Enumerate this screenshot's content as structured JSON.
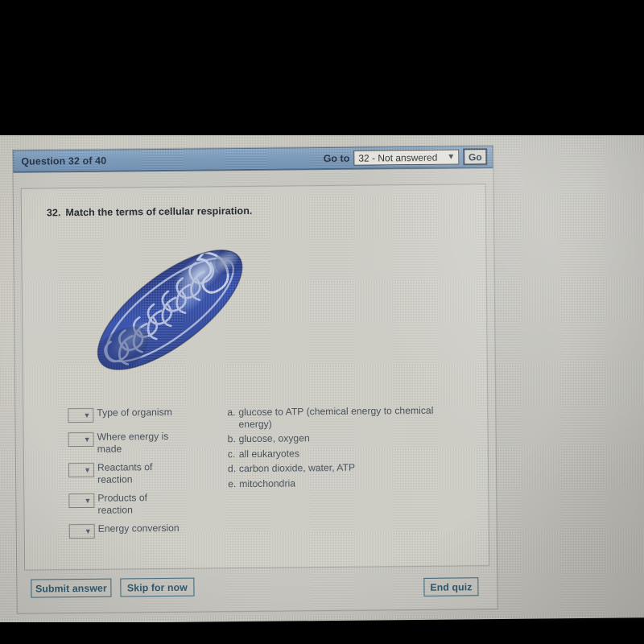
{
  "window": {
    "title_left": "Question 32 of 40",
    "goto_label": "Go to",
    "goto_value": "32 - Not answered",
    "goto_chevron": "chevron-down-icon",
    "go_button": "Go"
  },
  "question": {
    "number": "32.",
    "prompt": "Match the terms of cellular respiration.",
    "image_alt": "mitochondrion"
  },
  "terms": [
    {
      "label": "Type of organism",
      "value": "",
      "chevron": "∨"
    },
    {
      "label": "Where energy is made",
      "value": "",
      "chevron": "∨"
    },
    {
      "label": "Reactants of reaction",
      "value": "",
      "chevron": "∨"
    },
    {
      "label": "Products of reaction",
      "value": "",
      "chevron": "∨"
    },
    {
      "label": "Energy conversion",
      "value": "",
      "chevron": "∨"
    }
  ],
  "options": [
    {
      "letter": "a.",
      "text": "glucose to ATP (chemical energy to chemical energy)"
    },
    {
      "letter": "b.",
      "text": "glucose, oxygen"
    },
    {
      "letter": "c.",
      "text": "all eukaryotes"
    },
    {
      "letter": "d.",
      "text": "carbon dioxide, water, ATP"
    },
    {
      "letter": "e.",
      "text": "mitochondria"
    }
  ],
  "footer": {
    "submit": "Submit answer",
    "skip": "Skip for now",
    "end": "End quiz"
  },
  "colors": {
    "title_bar": "#7496b9",
    "screen_bg": "#c8c7c0",
    "panel_bg": "#cfcec6",
    "button_border": "#2c5c74",
    "button_text": "#1c4a63",
    "organelle_dark": "#152a6e",
    "organelle_mid": "#2742a0",
    "organelle_light": "#8fa6d8"
  }
}
